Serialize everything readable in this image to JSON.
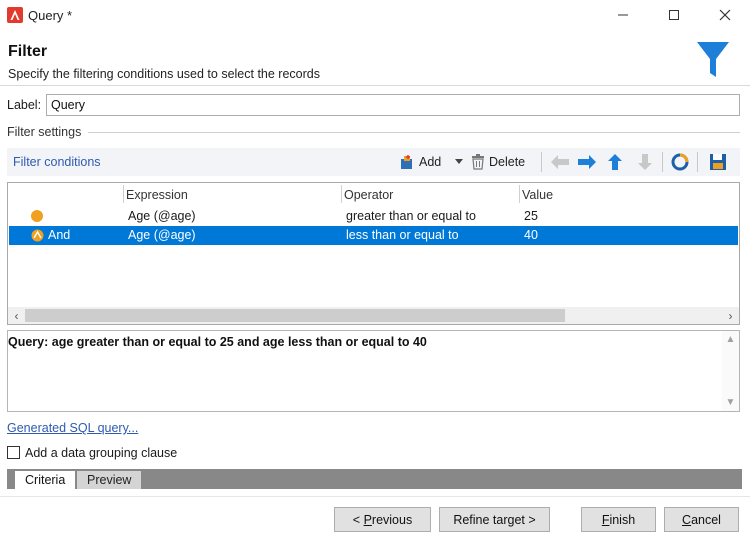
{
  "window": {
    "title": "Query *"
  },
  "header": {
    "title": "Filter",
    "subtitle": "Specify the filtering conditions used to select the records"
  },
  "label_field": {
    "label": "Label:",
    "value": "Query"
  },
  "filter_settings": {
    "title": "Filter settings"
  },
  "toolbar": {
    "conditions_label": "Filter conditions",
    "add_label": "Add",
    "delete_label": "Delete"
  },
  "grid": {
    "columns": [
      "Expression",
      "Operator",
      "Value"
    ],
    "rows": [
      {
        "logic": "",
        "expression": "Age (@age)",
        "operator": "greater than or equal to",
        "value": "25",
        "selected": false
      },
      {
        "logic": "And",
        "expression": "Age (@age)",
        "operator": "less than or equal to",
        "value": "40",
        "selected": true
      }
    ]
  },
  "query_text": "Query: age greater than or equal to 25 and age less than or equal to 40",
  "sql_link": "Generated SQL query...",
  "grouping": {
    "label": "Add a data grouping clause",
    "checked": false
  },
  "tabs": [
    {
      "label": "Criteria",
      "active": true
    },
    {
      "label": "Preview",
      "active": false
    }
  ],
  "buttons": {
    "previous": {
      "prefix": "< ",
      "mnemonic": "P",
      "rest": "revious"
    },
    "refine": "Refine target >",
    "finish": {
      "mnemonic": "F",
      "rest": "inish"
    },
    "cancel": {
      "mnemonic": "C",
      "rest": "ancel"
    }
  },
  "colors": {
    "accent_blue": "#0078d7",
    "link_blue": "#2f5bb0",
    "condition_orange": "#f0a020",
    "brand_red": "#e23b2e",
    "funnel_blue": "#1e7fd8"
  }
}
